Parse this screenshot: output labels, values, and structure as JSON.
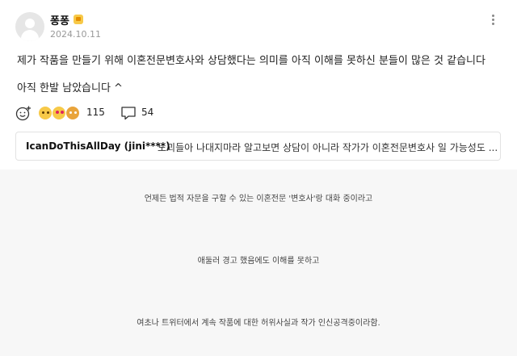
{
  "post": {
    "author": "퐁퐁",
    "date": "2024.10.11",
    "lines": [
      "제가 작품을 만들기 위해 이혼전문변호사와 상담했다는 의미를 아직 이해를 못하신 분들이 많은 것 같습니다",
      "아직 한발 남았습니다 ^"
    ],
    "reaction_count": "115",
    "comment_count": "54",
    "icons": {
      "menu": "more-vertical-icon",
      "add_reaction": "add-emoji-icon",
      "comment": "speech-bubble-icon"
    }
  },
  "best_comment": {
    "user": "IcanDoThisAllDay (jini****)",
    "text": "노괴들아 나대지마라 알고보면 상담이 아니라 작가가 이혼전문변호사 일 가능성도 ..."
  },
  "lower_lines": [
    "언제든 법적 자문을 구할 수 있는 이혼전문 '변호사'랑 대화 중이라고",
    "애둘러 경고 했음에도 이해를 못하고",
    "여초나 트위터에서 계속 작품에 대한 허위사실과 작가 인신공격중이라함."
  ],
  "colors": {
    "badge": "#f7c948",
    "lower_background": "#f7f7f7",
    "border": "#e2e2e2"
  }
}
